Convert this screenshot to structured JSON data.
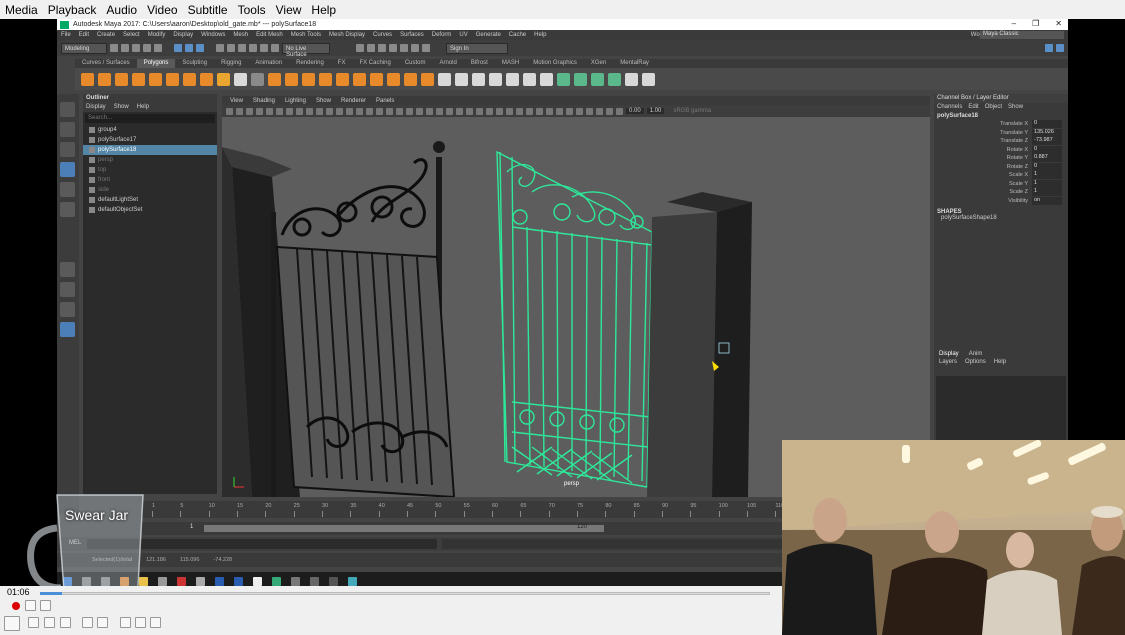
{
  "player": {
    "menu": [
      "Media",
      "Playback",
      "Audio",
      "Video",
      "Subtitle",
      "Tools",
      "View",
      "Help"
    ],
    "time": "01:06",
    "progress": 0.03
  },
  "maya": {
    "title": "Autodesk Maya 2017: C:\\Users\\aaron\\Desktop\\old_gate.mb*   ---   polySurface18",
    "window_controls": [
      "–",
      "❐",
      "✕"
    ],
    "menu": [
      "File",
      "Edit",
      "Create",
      "Select",
      "Modify",
      "Display",
      "Windows",
      "Mesh",
      "Edit Mesh",
      "Mesh Tools",
      "Mesh Display",
      "Curves",
      "Surfaces",
      "Deform",
      "UV",
      "Generate",
      "Cache",
      "Help"
    ],
    "workspace_label": "Workspace :",
    "workspace_value": "Maya Classic",
    "mode": "Modeling",
    "live_surface": "No Live Surface",
    "sign_in": "Sign In",
    "shelf_tabs": [
      "Curves / Surfaces",
      "Polygons",
      "Sculpting",
      "Rigging",
      "Animation",
      "Rendering",
      "FX",
      "FX Caching",
      "Custom",
      "Arnold",
      "Bifrost",
      "MASH",
      "Motion Graphics",
      "XGen",
      "MentalRay"
    ],
    "shelf_active": "Polygons",
    "outliner": {
      "title": "Outliner",
      "menu": [
        "Display",
        "Show",
        "Help"
      ],
      "search_placeholder": "Search...",
      "items": [
        {
          "label": "group4",
          "state": "normal"
        },
        {
          "label": "polySurface17",
          "state": "normal"
        },
        {
          "label": "polySurface18",
          "state": "selected"
        },
        {
          "label": "persp",
          "state": "dim"
        },
        {
          "label": "top",
          "state": "dim"
        },
        {
          "label": "front",
          "state": "dim"
        },
        {
          "label": "side",
          "state": "dim"
        },
        {
          "label": "defaultLightSet",
          "state": "normal"
        },
        {
          "label": "defaultObjectSet",
          "state": "normal"
        }
      ]
    },
    "viewport": {
      "menu": [
        "View",
        "Shading",
        "Lighting",
        "Show",
        "Renderer",
        "Panels"
      ],
      "field1": "0.00",
      "field2": "1.00",
      "colorspace": "sRGB gamma",
      "camera": "persp"
    },
    "channel_box": {
      "title": "Channel Box / Layer Editor",
      "menu": [
        "Channels",
        "Edit",
        "Object",
        "Show"
      ],
      "object": "polySurface18",
      "channels": [
        {
          "name": "Translate X",
          "value": "0"
        },
        {
          "name": "Translate Y",
          "value": "135.026"
        },
        {
          "name": "Translate Z",
          "value": "-73.987"
        },
        {
          "name": "Rotate X",
          "value": "0"
        },
        {
          "name": "Rotate Y",
          "value": "0.887"
        },
        {
          "name": "Rotate Z",
          "value": "0"
        },
        {
          "name": "Scale X",
          "value": "1"
        },
        {
          "name": "Scale Y",
          "value": "1"
        },
        {
          "name": "Scale Z",
          "value": "1"
        },
        {
          "name": "Visibility",
          "value": "on"
        }
      ],
      "shapes_label": "SHAPES",
      "shape_name": "polySurfaceShape18",
      "layer_tabs": [
        "Display",
        "Anim"
      ],
      "layer_menu": [
        "Layers",
        "Options",
        "Help"
      ]
    },
    "timeline": {
      "ticks": [
        "1",
        "5",
        "10",
        "15",
        "20",
        "25",
        "30",
        "35",
        "40",
        "45",
        "50",
        "55",
        "60",
        "65",
        "70",
        "75",
        "80",
        "85",
        "90",
        "95",
        "100",
        "105",
        "110",
        "115",
        "120"
      ],
      "range_start": "1",
      "range_end": "120",
      "cmd_label": "MEL",
      "help_items": [
        "Selected(1)/total",
        "121.186",
        "115.096",
        "-74.228"
      ]
    }
  },
  "overlay": {
    "swear_jar": "Swear Jar"
  }
}
